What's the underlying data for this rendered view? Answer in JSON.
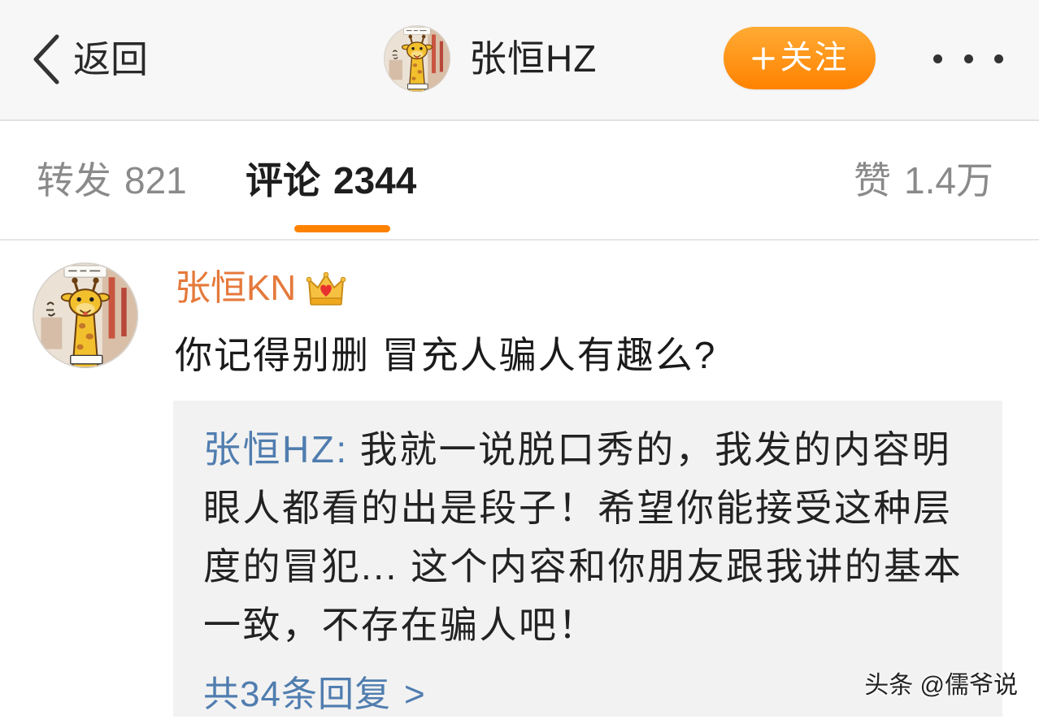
{
  "header": {
    "back_label": "返回",
    "title": "张恒HZ",
    "follow_label": "关注",
    "icons": {
      "back": "chevron-left-icon",
      "avatar": "giraffe-avatar",
      "follow": "plus-icon",
      "more": "more-dots-icon"
    }
  },
  "tabs": [
    {
      "label": "转发",
      "count": "821",
      "active": false
    },
    {
      "label": "评论",
      "count": "2344",
      "active": true
    },
    {
      "label": "赞",
      "count": "1.4万",
      "active": false
    }
  ],
  "comment": {
    "username": "张恒KN",
    "badge_icon": "vip-crown-icon",
    "text": "你记得别删 冒充人骗人有趣么?",
    "reply": {
      "author": "张恒HZ:",
      "lines": [
        "我就一说脱口秀的，我发的内容明",
        "眼人都看的出是段子！希望你能接受这种层",
        "度的冒犯... 这个内容和你朋友跟我讲的基本",
        "一致，不存在骗人吧！"
      ],
      "more_label": "共34条回复",
      "more_chevron": ">"
    }
  },
  "watermark": "头条 @儒爷说",
  "colors": {
    "header_bg": "#f7f7f7",
    "accent": "#ff8200",
    "username": "#e5793b",
    "link": "#507daf",
    "text": "#1a1a1a",
    "muted": "#8a8a8a",
    "reply_bg": "#f2f2f2"
  }
}
